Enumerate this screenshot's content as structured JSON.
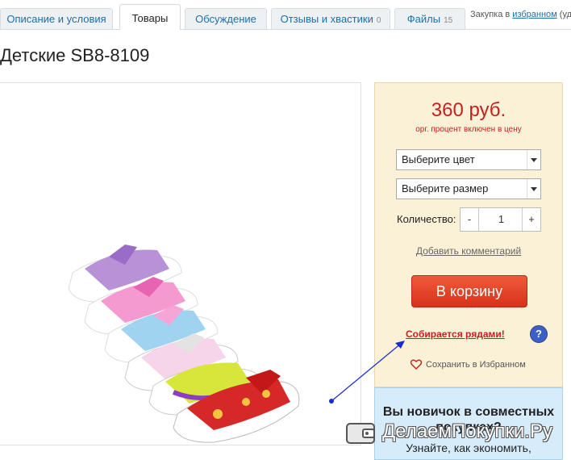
{
  "tabs": [
    {
      "label": "Описание и условия",
      "count": ""
    },
    {
      "label": "Товары",
      "count": ""
    },
    {
      "label": "Обсуждение",
      "count": ""
    },
    {
      "label": "Отзывы и хвастики",
      "count": "0"
    },
    {
      "label": "Файлы",
      "count": "15"
    }
  ],
  "collect": {
    "prefix": "Закупка в ",
    "link": "избранном",
    "suffix": " (уд"
  },
  "product": {
    "title": "Детские SB8-8109"
  },
  "buy": {
    "price": "360 руб.",
    "price_note": "орг. процент включен в цену",
    "color_select": "Выберите цвет",
    "size_select": "Выберите размер",
    "qty_label": "Количество:",
    "qty_minus": "-",
    "qty_value": "1",
    "qty_plus": "+",
    "add_comment": "Добавить комментарий",
    "cart_button": "В корзину",
    "rows_link": "Собирается рядами!",
    "help": "?",
    "save_fav": "Сохранить в Избранном"
  },
  "newbie": {
    "title": "Вы новичок в совместных покупках?",
    "text": "Узнайте, как экономить,"
  },
  "watermark": {
    "text": "ДелаемПокупки.Ру"
  },
  "colors": {
    "accent_red": "#c71f1f",
    "link_blue": "#1f6fa8",
    "buy_panel_bg": "#fbf1d7",
    "newbie_bg": "#d7ecfb"
  },
  "icons": [
    "dropdown-arrow-icon",
    "help-icon",
    "heart-icon",
    "wallet-icon"
  ]
}
